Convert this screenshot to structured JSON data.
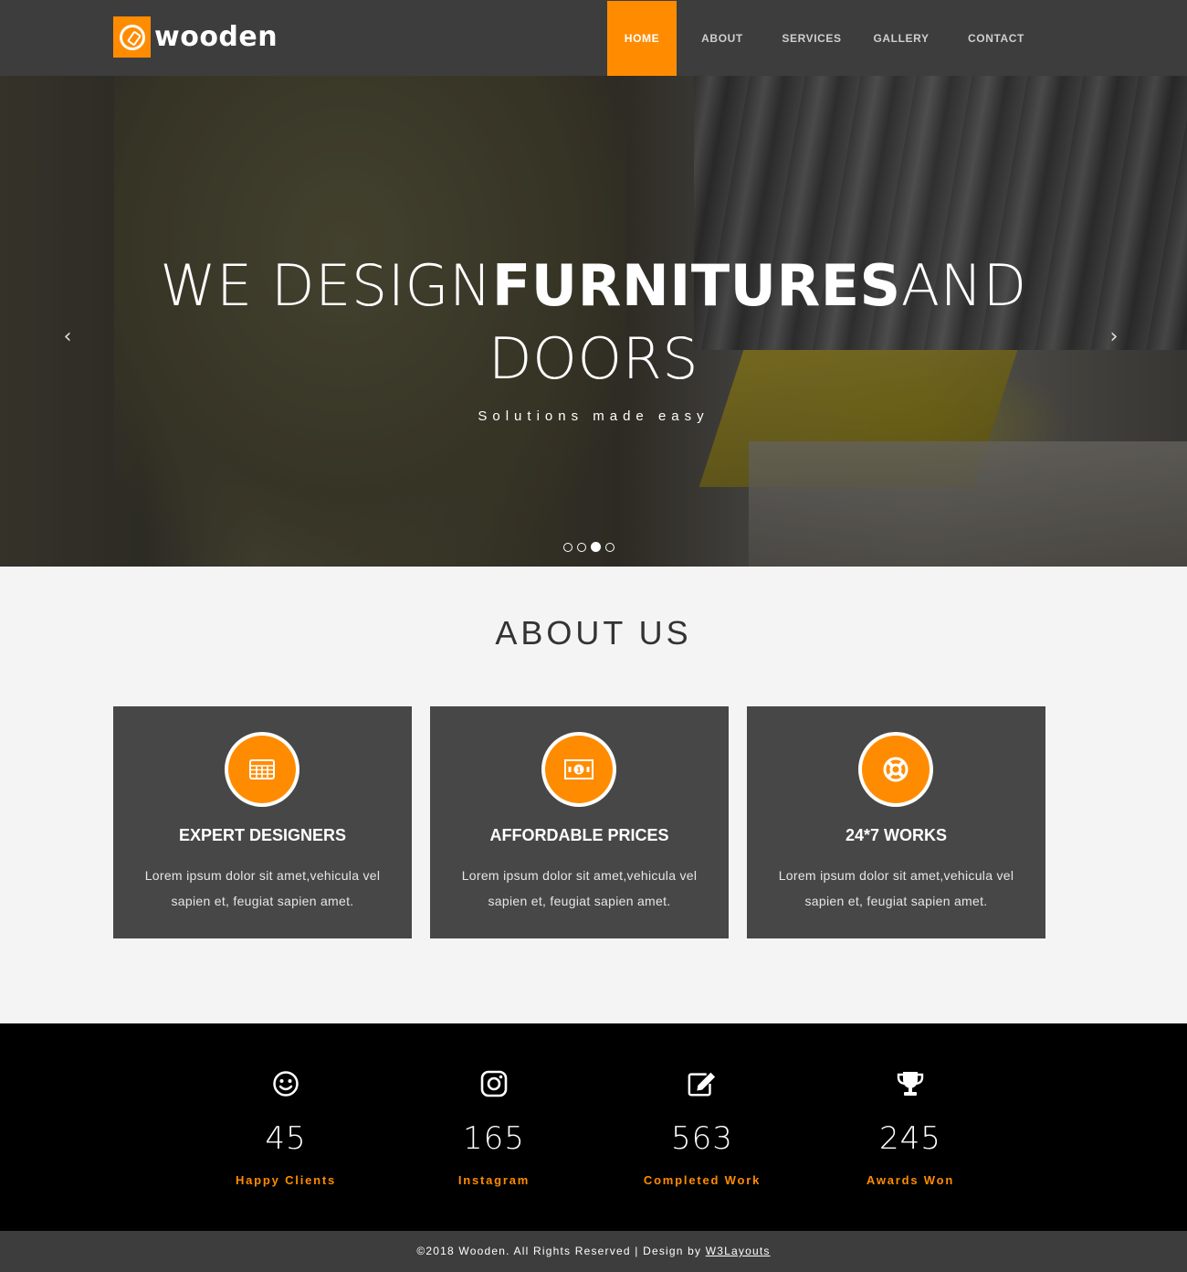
{
  "brand": {
    "name": "wooden",
    "logo_icon": "compass-icon"
  },
  "nav": {
    "items": [
      {
        "label": "HOME",
        "active": true
      },
      {
        "label": "ABOUT",
        "active": false
      },
      {
        "label": "SERVICES",
        "active": false
      },
      {
        "label": "GALLERY",
        "active": false
      },
      {
        "label": "CONTACT",
        "active": false
      }
    ]
  },
  "hero": {
    "title_pre": "WE DESIGN",
    "title_bold": "FURNITURES",
    "title_post": "AND DOORS",
    "subtitle": "Solutions made easy",
    "slides_total": 4,
    "active_slide": 3
  },
  "about": {
    "title": "ABOUT US",
    "cards": [
      {
        "icon": "table-grid-icon",
        "title": "EXPERT DESIGNERS",
        "text": "Lorem ipsum dolor sit amet,vehicula vel sapien et, feugiat sapien amet."
      },
      {
        "icon": "money-bill-icon",
        "title": "AFFORDABLE PRICES",
        "text": "Lorem ipsum dolor sit amet,vehicula vel sapien et, feugiat sapien amet."
      },
      {
        "icon": "life-ring-icon",
        "title": "24*7 WORKS",
        "text": "Lorem ipsum dolor sit amet,vehicula vel sapien et, feugiat sapien amet."
      }
    ]
  },
  "stats": [
    {
      "icon": "smile-icon",
      "value": "45",
      "label": "Happy Clients"
    },
    {
      "icon": "instagram-icon",
      "value": "165",
      "label": "Instagram"
    },
    {
      "icon": "edit-icon",
      "value": "563",
      "label": "Completed Work"
    },
    {
      "icon": "trophy-icon",
      "value": "245",
      "label": "Awards Won"
    }
  ],
  "footer": {
    "text": "©2018 Wooden. All Rights Reserved | Design by ",
    "link": "W3Layouts"
  },
  "colors": {
    "accent": "#ff8c00",
    "header_bg": "#3d3d3d",
    "card_bg": "#474747",
    "stats_bg": "#000000"
  }
}
